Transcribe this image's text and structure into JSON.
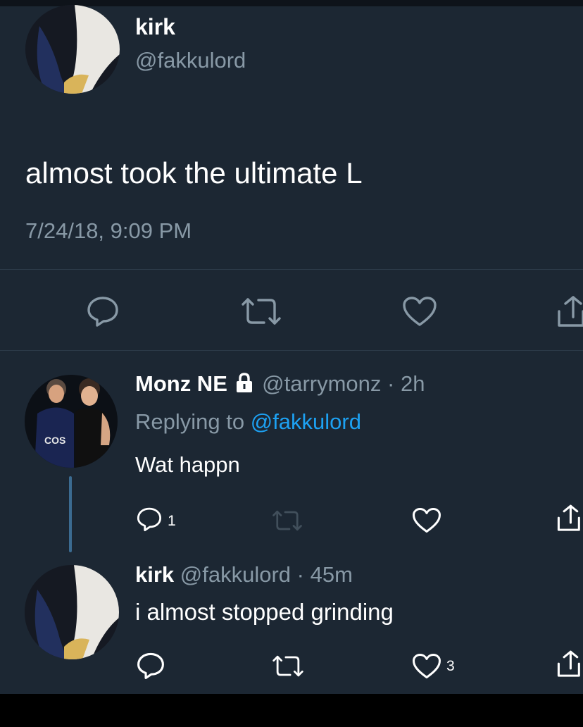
{
  "main_tweet": {
    "name": "kirk",
    "handle": "@fakkulord",
    "text": "almost took the ultimate L",
    "timestamp": "7/24/18, 9:09 PM",
    "actions": [
      "reply-icon",
      "retweet-icon",
      "like-icon",
      "share-icon"
    ]
  },
  "replies": [
    {
      "name": "Monz NE",
      "lock_icon": "lock-icon",
      "handle_time": "@tarrymonz · 2h",
      "replying_prefix": "Replying to",
      "replying_to": "@fakkulord",
      "text": "Wat happn",
      "reply_count": "1",
      "like_count": ""
    },
    {
      "name": "kirk",
      "handle_time": "@fakkulord · 45m",
      "text": "i almost stopped grinding",
      "reply_count": "",
      "like_count": "3"
    }
  ],
  "colors": {
    "background": "#1c2733",
    "muted": "#8899a6",
    "link": "#1da1f2",
    "thread_line": "#3b6b91"
  }
}
